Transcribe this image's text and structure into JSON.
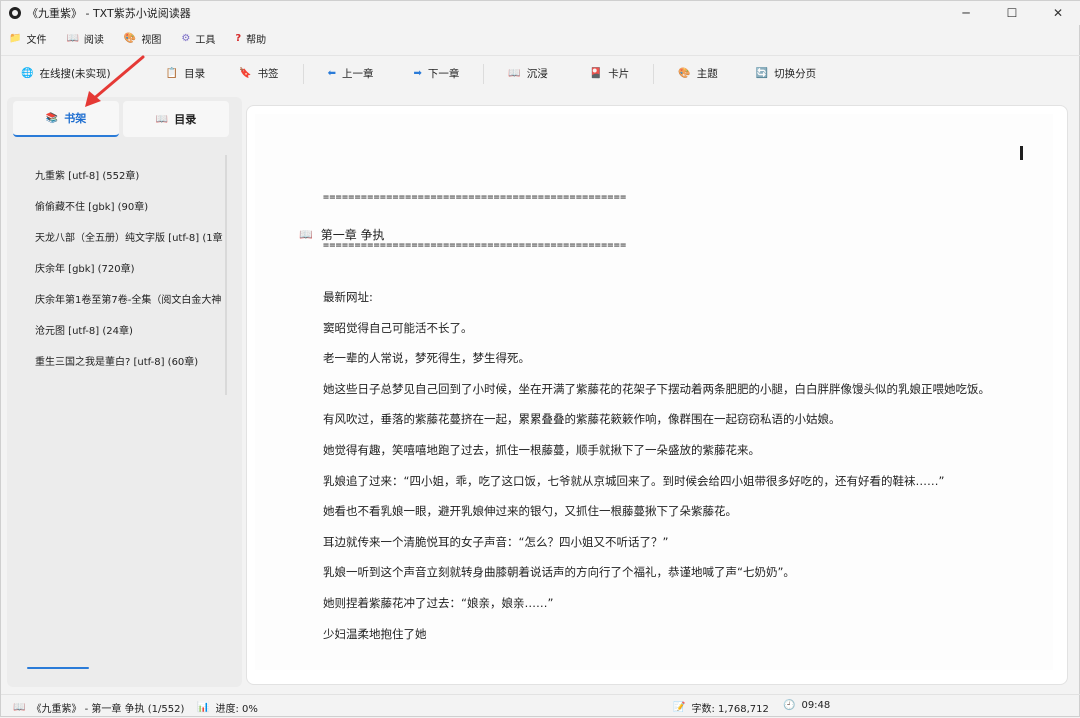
{
  "window": {
    "title": "《九重紫》 - TXT紫苏小说阅读器",
    "controls": [
      "─",
      "☐",
      "✕"
    ]
  },
  "menu": [
    {
      "label": "文件",
      "icon": "folder-icon",
      "glyph": "📁"
    },
    {
      "label": "阅读",
      "icon": "book-icon",
      "glyph": "📖"
    },
    {
      "label": "视图",
      "icon": "palette-icon",
      "glyph": "🎨"
    },
    {
      "label": "工具",
      "icon": "gear-icon",
      "glyph": "⚙"
    },
    {
      "label": "帮助",
      "icon": "help-icon",
      "glyph": "?"
    }
  ],
  "toolbar": {
    "online_search": "在线搜(未实现)",
    "toc": "目录",
    "bookmark": "书签",
    "prev_chapter": "上一章",
    "next_chapter": "下一章",
    "immersive": "沉浸",
    "card": "卡片",
    "theme": "主题",
    "paging": "切换分页"
  },
  "sidebar": {
    "tabs": [
      {
        "label": "书架",
        "active": true
      },
      {
        "label": "目录",
        "active": false
      }
    ],
    "books": [
      "九重紫 [utf-8] (552章)",
      "偷偷藏不住 [gbk] (90章)",
      "天龙八部（全五册）纯文字版 [utf-8] (1章",
      "庆余年 [gbk] (720章)",
      "庆余年第1卷至第7卷-全集（阅文白金大神",
      "沧元图 [utf-8] (24章)",
      "重生三国之我是董白? [utf-8] (60章)"
    ]
  },
  "reader": {
    "divider": "================================================",
    "chapter_title": "第一章 争执",
    "paragraphs": [
      "最新网址:",
      "窦昭觉得自己可能活不长了。",
      "老一辈的人常说，梦死得生，梦生得死。",
      "她这些日子总梦见自己回到了小时候，坐在开满了紫藤花的花架子下摆动着两条肥肥的小腿，白白胖胖像馒头似的乳娘正喂她吃饭。",
      "有风吹过，垂落的紫藤花蔓挤在一起，累累叠叠的紫藤花簌簌作响，像群围在一起窃窃私语的小姑娘。",
      "她觉得有趣，笑嘻嘻地跑了过去，抓住一根藤蔓，顺手就揪下了一朵盛放的紫藤花来。",
      "乳娘追了过来：“四小姐，乖，吃了这口饭，七爷就从京城回来了。到时候会给四小姐带很多好吃的，还有好看的鞋袜……”",
      "她看也不看乳娘一眼，避开乳娘伸过来的银勺，又抓住一根藤蔓揪下了朵紫藤花。",
      "耳边就传来一个清脆悦耳的女子声音：“怎么？四小姐又不听话了？”",
      "乳娘一听到这个声音立刻就转身曲膝朝着说话声的方向行了个福礼，恭谨地喊了声“七奶奶”。",
      "她则捏着紫藤花冲了过去：“娘亲，娘亲……”",
      "少妇温柔地抱住了她"
    ]
  },
  "status": {
    "book_info": "《九重紫》 - 第一章 争执 (1/552)",
    "progress": "进度: 0%",
    "word_count": "字数: 1,768,712",
    "time": "09:48"
  },
  "colors": {
    "accent": "#2a7bd8",
    "annotation_arrow": "#e53935"
  }
}
